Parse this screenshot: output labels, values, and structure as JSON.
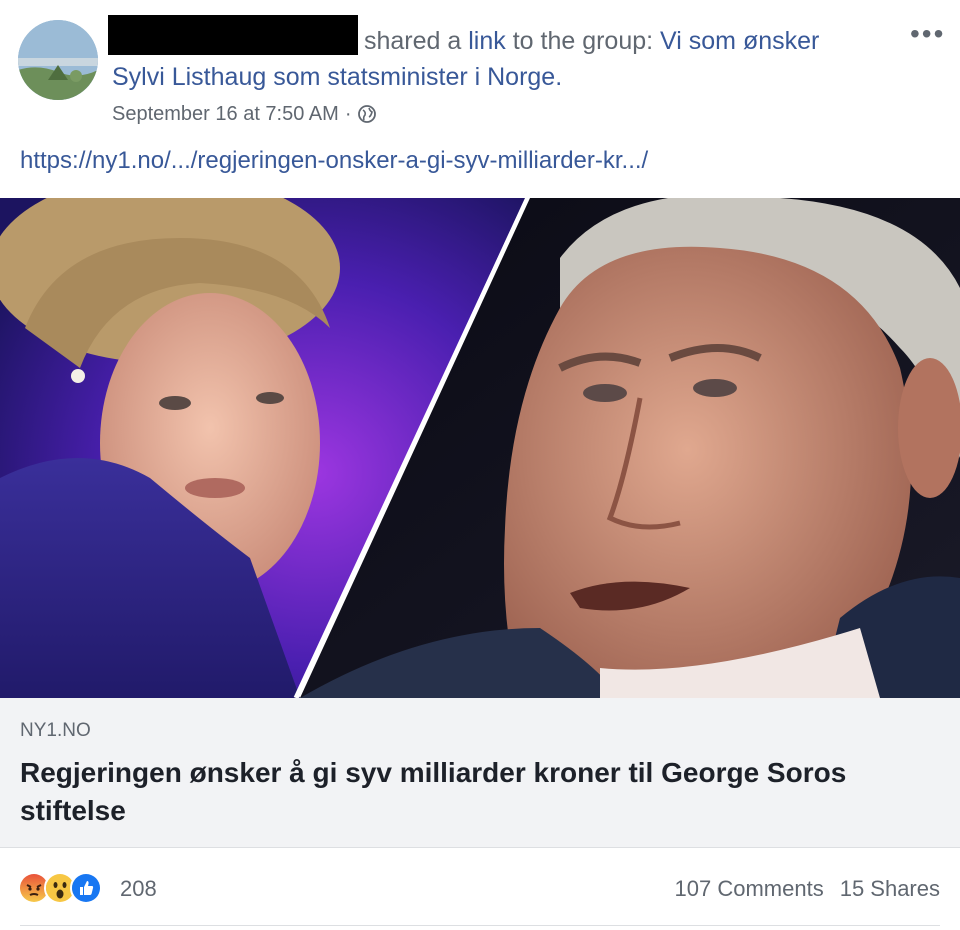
{
  "post": {
    "shared_text": "shared a ",
    "link_word": "link",
    "to_group_text": " to the group: ",
    "group_name_part1": "Vi som ønsker",
    "group_name_part2": "Sylvi Listhaug som statsminister i Norge.",
    "timestamp": "September 16 at 7:50 AM",
    "separator": "·",
    "more_label": "•••",
    "url": "https://ny1.no/.../regjeringen-onsker-a-gi-syv-milliarder-kr.../"
  },
  "link_preview": {
    "domain": "NY1.NO",
    "title": "Regjeringen ønsker å gi syv milliarder kroner til George Soros stiftelse"
  },
  "engagement": {
    "reaction_icons": [
      "angry-icon",
      "wow-icon",
      "like-icon"
    ],
    "reaction_count": "208",
    "comments": "107 Comments",
    "shares": "15 Shares"
  },
  "colors": {
    "link": "#385898",
    "meta": "#606770",
    "caption_bg": "#f2f3f5"
  }
}
